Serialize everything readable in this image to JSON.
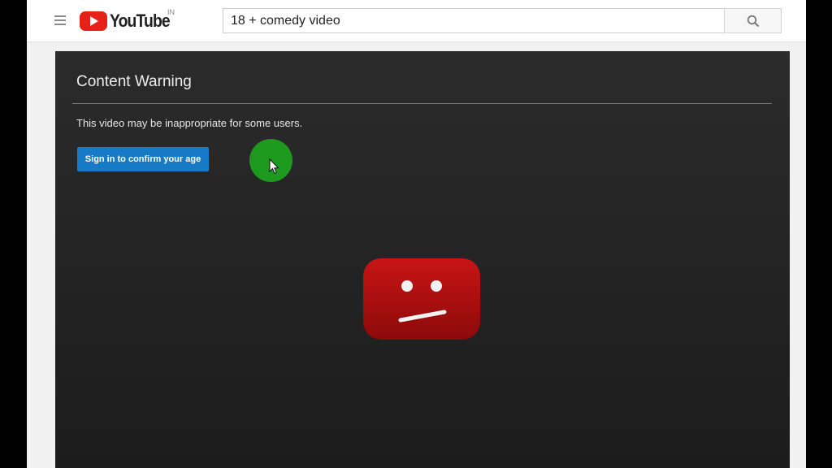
{
  "masthead": {
    "logo_text": "YouTube",
    "region": "IN",
    "search_query": "18 + comedy video"
  },
  "player": {
    "warning_title": "Content Warning",
    "warning_message": "This video may be inappropriate for some users.",
    "confirm_button_label": "Sign in to confirm your age"
  },
  "icons": {
    "menu": "hamburger-menu-icon",
    "search": "magnifier-icon",
    "logo": "youtube-play-icon",
    "error": "sad-tv-face-icon",
    "cursor": "mouse-pointer-icon"
  },
  "colors": {
    "brand_red": "#e62117",
    "button_blue": "#167ac6",
    "click_marker_green": "#1d9a1d",
    "error_icon_red": "#a50d0d"
  }
}
